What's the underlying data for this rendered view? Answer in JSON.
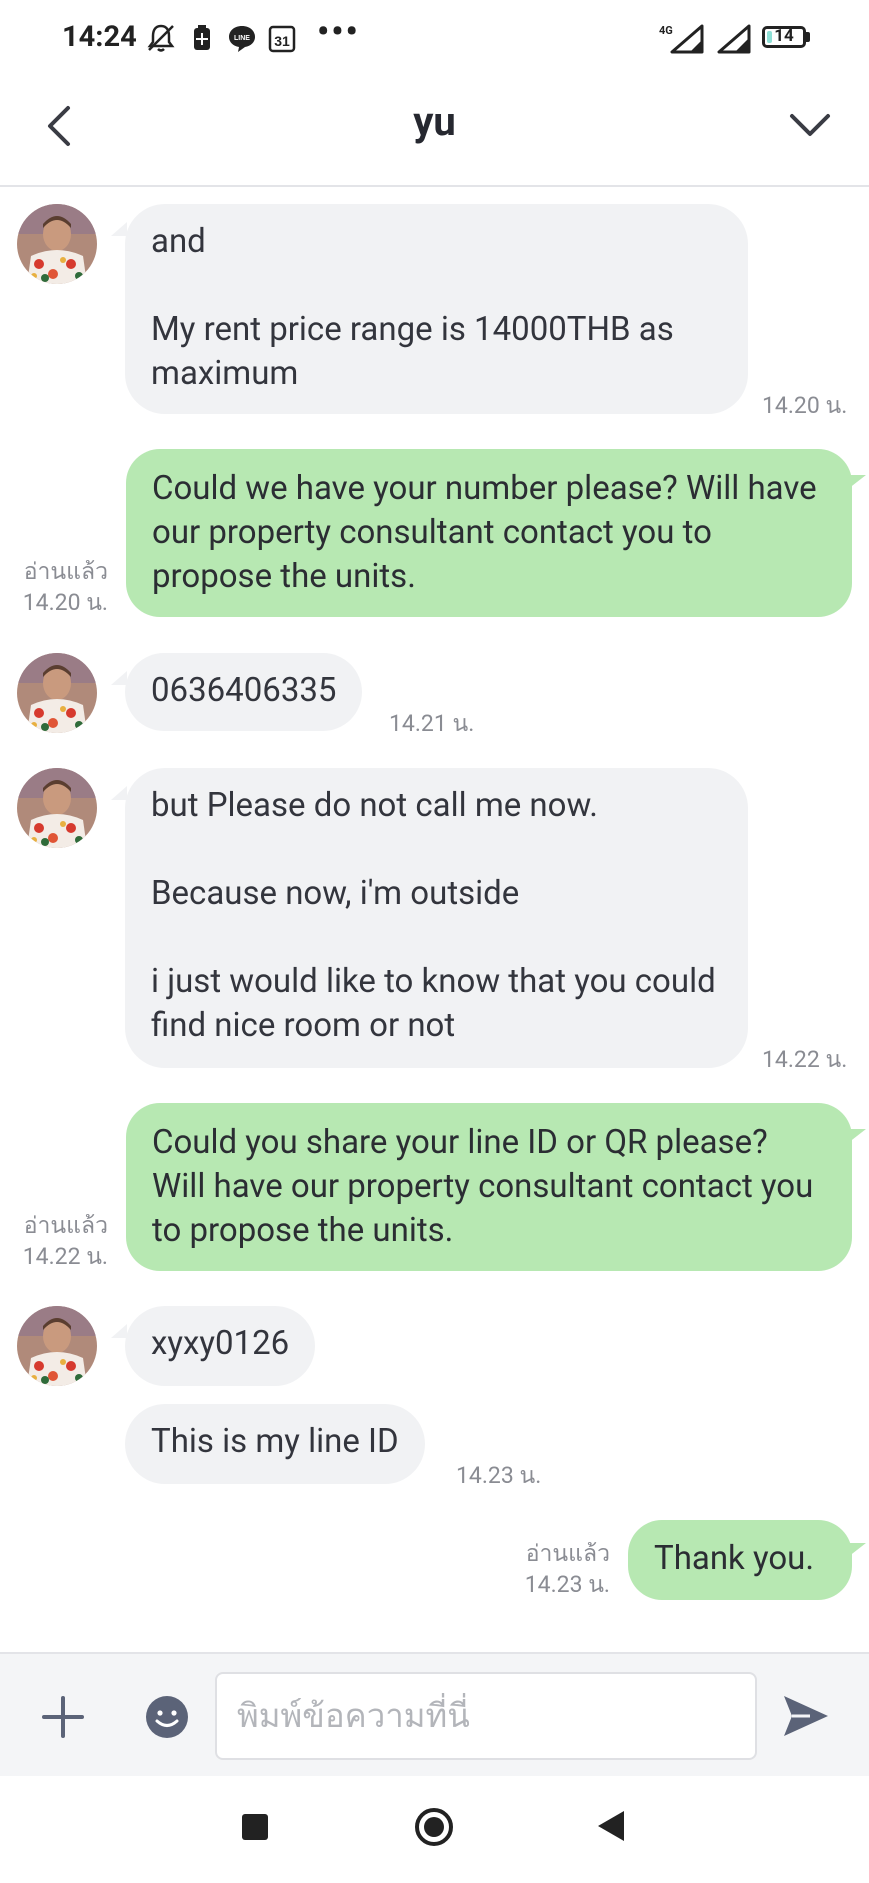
{
  "status_bar": {
    "time": "14:24",
    "network": "4G",
    "battery": "14",
    "battery_level": 0.14,
    "calendar_day": "31",
    "more": "•••"
  },
  "header": {
    "title": "yu"
  },
  "messages": [
    {
      "side": "in",
      "text": "and\n\nMy rent price range is 14000THB as maximum",
      "time": "14.20 น."
    },
    {
      "side": "out",
      "text": "Could we have your number please? Will have our property consultant contact you to propose the units.",
      "status": "อ่านแล้ว",
      "time": "14.20 น."
    },
    {
      "side": "in",
      "text": "0636406335",
      "time": "14.21 น."
    },
    {
      "side": "in",
      "text": "but Please do not call me now.\n\nBecause now, i'm outside\n\ni just would like to know that you could find nice room or not",
      "time": "14.22 น."
    },
    {
      "side": "out",
      "text": "Could you share your line ID or QR please? Will have our property consultant contact you to propose the units.",
      "status": "อ่านแล้ว",
      "time": "14.22 น."
    },
    {
      "side": "in",
      "text": "xyxy0126"
    },
    {
      "side": "in",
      "text": "This is my line ID",
      "time": "14.23 น."
    },
    {
      "side": "out",
      "text": "Thank you.",
      "status": "อ่านแล้ว",
      "time": "14.23 น."
    }
  ],
  "composer": {
    "placeholder": "พิมพ์ข้อความที่นี่"
  },
  "colors": {
    "incoming_bubble": "#f1f2f4",
    "outgoing_bubble": "#b7e8b2",
    "icon_accent": "#5b6378"
  }
}
